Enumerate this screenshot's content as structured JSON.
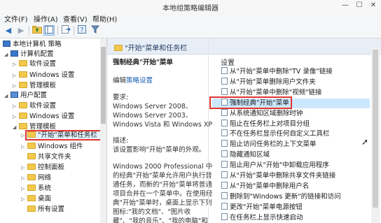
{
  "window": {
    "title": "本地组策略编辑器",
    "minimize": "—",
    "maximize": "☐",
    "close": "✕"
  },
  "menu": [
    "文件(F)",
    "操作(A)",
    "查看(V)",
    "帮助(H)"
  ],
  "toolbar": [
    "back-icon",
    "forward-icon",
    "up-folder-icon",
    "show-tree-icon",
    "export-icon",
    "help-icon",
    "filter-icon"
  ],
  "tree": {
    "root": "本地计算机 策略",
    "computer_config": "计算机配置",
    "cc_software": "软件设置",
    "cc_windows": "Windows 设置",
    "cc_admin": "管理模板",
    "user_config": "用户配置",
    "uc_software": "软件设置",
    "uc_windows": "Windows 设置",
    "uc_admin": "管理模板",
    "start_menu": "\"开始\"菜单和任务栏",
    "windows_components": "Windows 组件",
    "shared_folders": "共享文件夹",
    "control_panel": "控制面板",
    "network": "网络",
    "system": "系统",
    "desktop": "桌面",
    "all_settings": "所有设置"
  },
  "main": {
    "header": "\"开始\"菜单和任务栏",
    "desc_title": "强制经典\"开始\"菜单",
    "edit_prefix": "编辑",
    "edit_link": "策略设置",
    "requirements_label": "要求:",
    "requirements": "Windows Server 2008、Windows Server 2003、Windows Vista 和 Windows XP",
    "description_label": "描述:",
    "description": "该设置影响\"开始\"菜单的外观。",
    "description_body": "Windows 2000 Professional 中的经典\"开始\"菜单允许用户执行普通任务，而新的\"开始\"菜单将普通项目合并在一个菜单中。在使用经典\"开始\"菜单时，桌面上显示下列图标:\"我的文档\"、\"图片收藏\"、\"我的音乐\"、\"我的电脑\"和"
  },
  "list": {
    "column": "设置",
    "items": [
      "从\"开始\"菜单中删除\"TV 录像\"链接",
      "从\"开始\"菜单删除用户文件夹",
      "从\"开始\"菜单中删除\"视频\"链接",
      "强制经典\"开始\"菜单",
      "从系统通知区域删除时钟",
      "阻止在任务栏上对项目分组",
      "不在任务栏显示任何自定义工具栏",
      "阻止访问任务栏的上下文菜单",
      "隐藏通知区域",
      "阻止用户从\"开始\"中卸载应用程序",
      "从\"开始\"菜单中删除共享文件夹链接",
      "从\"开始\"菜单中删除用户名",
      "删除到\"Windows 更新\"的链接和访问",
      "更改\"开始\"菜单电源按钮",
      "在任务栏上显示快速启动"
    ],
    "selected_index": 3
  },
  "colors": {
    "accent": "#cce8ff",
    "highlight_box": "#e3342f",
    "link": "#1a5fb4"
  }
}
